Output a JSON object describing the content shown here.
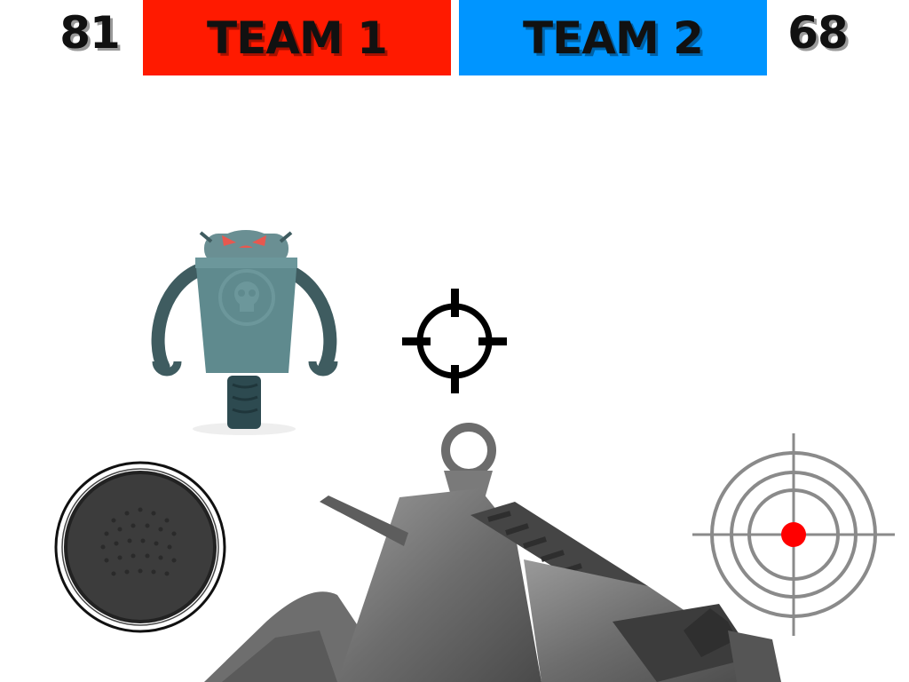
{
  "scoreboard": {
    "team1_score": "81",
    "team2_score": "68",
    "team1_label": "TEAM 1",
    "team2_label": "TEAM 2"
  },
  "colors": {
    "team1": "#ff1a00",
    "team2": "#0095ff",
    "robot_body": "#5a8287",
    "robot_eye": "#e8584f",
    "target_dot": "#ff0000",
    "target_rings": "#8a8a8a"
  },
  "icons": {
    "enemy": "robot-enemy-icon",
    "aim": "crosshair-icon",
    "move": "joystick-icon",
    "fire": "fire-target-icon",
    "weapon": "rifle-icon"
  }
}
